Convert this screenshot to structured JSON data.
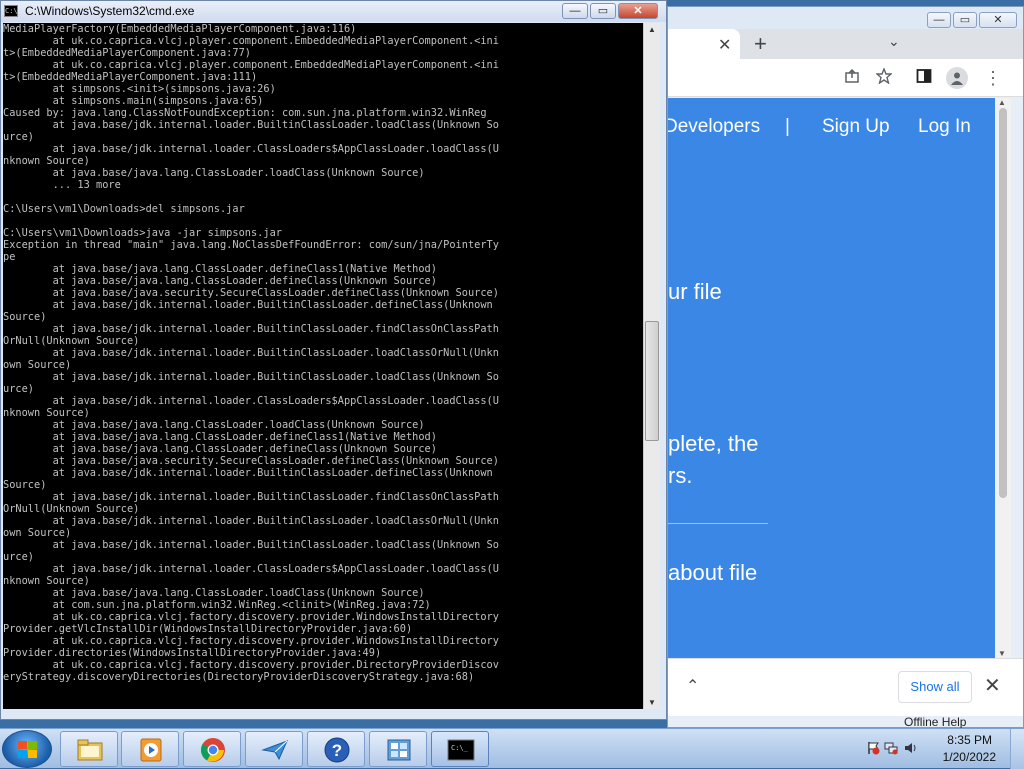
{
  "cmd": {
    "title": "C:\\Windows\\System32\\cmd.exe",
    "buttons": {
      "minimize": "—",
      "maximize": "▭",
      "close": "✕"
    },
    "icon_label": "C:\\_",
    "output": "MediaPlayerFactory(EmbeddedMediaPlayerComponent.java:116)\n        at uk.co.caprica.vlcj.player.component.EmbeddedMediaPlayerComponent.<init>(EmbeddedMediaPlayerComponent.java:77)\n        at uk.co.caprica.vlcj.player.component.EmbeddedMediaPlayerComponent.<init>(EmbeddedMediaPlayerComponent.java:111)\n        at simpsons.<init>(simpsons.java:26)\n        at simpsons.main(simpsons.java:65)\nCaused by: java.lang.ClassNotFoundException: com.sun.jna.platform.win32.WinReg\n        at java.base/jdk.internal.loader.BuiltinClassLoader.loadClass(Unknown Source)\n        at java.base/jdk.internal.loader.ClassLoaders$AppClassLoader.loadClass(Unknown Source)\n        at java.base/java.lang.ClassLoader.loadClass(Unknown Source)\n        ... 13 more\n\nC:\\Users\\vm1\\Downloads>del simpsons.jar\n\nC:\\Users\\vm1\\Downloads>java -jar simpsons.jar\nException in thread \"main\" java.lang.NoClassDefFoundError: com/sun/jna/PointerType\n        at java.base/java.lang.ClassLoader.defineClass1(Native Method)\n        at java.base/java.lang.ClassLoader.defineClass(Unknown Source)\n        at java.base/java.security.SecureClassLoader.defineClass(Unknown Source)\n        at java.base/jdk.internal.loader.BuiltinClassLoader.defineClass(Unknown Source)\n        at java.base/jdk.internal.loader.BuiltinClassLoader.findClassOnClassPathOrNull(Unknown Source)\n        at java.base/jdk.internal.loader.BuiltinClassLoader.loadClassOrNull(Unknown Source)\n        at java.base/jdk.internal.loader.BuiltinClassLoader.loadClass(Unknown Source)\n        at java.base/jdk.internal.loader.ClassLoaders$AppClassLoader.loadClass(Unknown Source)\n        at java.base/java.lang.ClassLoader.loadClass(Unknown Source)\n        at java.base/java.lang.ClassLoader.defineClass1(Native Method)\n        at java.base/java.lang.ClassLoader.defineClass(Unknown Source)\n        at java.base/java.security.SecureClassLoader.defineClass(Unknown Source)\n        at java.base/jdk.internal.loader.BuiltinClassLoader.defineClass(Unknown Source)\n        at java.base/jdk.internal.loader.BuiltinClassLoader.findClassOnClassPathOrNull(Unknown Source)\n        at java.base/jdk.internal.loader.BuiltinClassLoader.loadClassOrNull(Unknown Source)\n        at java.base/jdk.internal.loader.BuiltinClassLoader.loadClass(Unknown Source)\n        at java.base/jdk.internal.loader.ClassLoaders$AppClassLoader.loadClass(Unknown Source)\n        at java.base/java.lang.ClassLoader.loadClass(Unknown Source)\n        at com.sun.jna.platform.win32.WinReg.<clinit>(WinReg.java:72)\n        at uk.co.caprica.vlcj.factory.discovery.provider.WindowsInstallDirectoryProvider.getVlcInstallDir(WindowsInstallDirectoryProvider.java:60)\n        at uk.co.caprica.vlcj.factory.discovery.provider.WindowsInstallDirectoryProvider.directories(WindowsInstallDirectoryProvider.java:49)\n        at uk.co.caprica.vlcj.factory.discovery.provider.DirectoryProviderDiscoveryStrategy.discoveryDirectories(DirectoryProviderDiscoveryStrategy.java:68)"
  },
  "browser": {
    "buttons": {
      "minimize": "—",
      "maximize": "▭",
      "close": "✕"
    },
    "tab_close": "✕",
    "new_tab": "+",
    "tab_search": "⌄",
    "nav": {
      "developers": "Developers",
      "separator": "|",
      "sign_up": "Sign Up",
      "log_in": "Log In"
    },
    "fragments": {
      "line1": "ur file",
      "line2": "plete, the",
      "line3": "rs.",
      "line4": "about file"
    },
    "download_bar": {
      "show_all": "Show all",
      "close": "✕",
      "chevron": "⌃"
    },
    "offline_help": "Offline Help",
    "colors": {
      "page_bg": "#3b87e6"
    }
  },
  "taskbar": {
    "items": [
      "windows-explorer",
      "media-player",
      "chrome",
      "paper-plane-app",
      "help",
      "control-panel",
      "cmd"
    ],
    "time": "8:35 PM",
    "date": "1/20/2022"
  }
}
